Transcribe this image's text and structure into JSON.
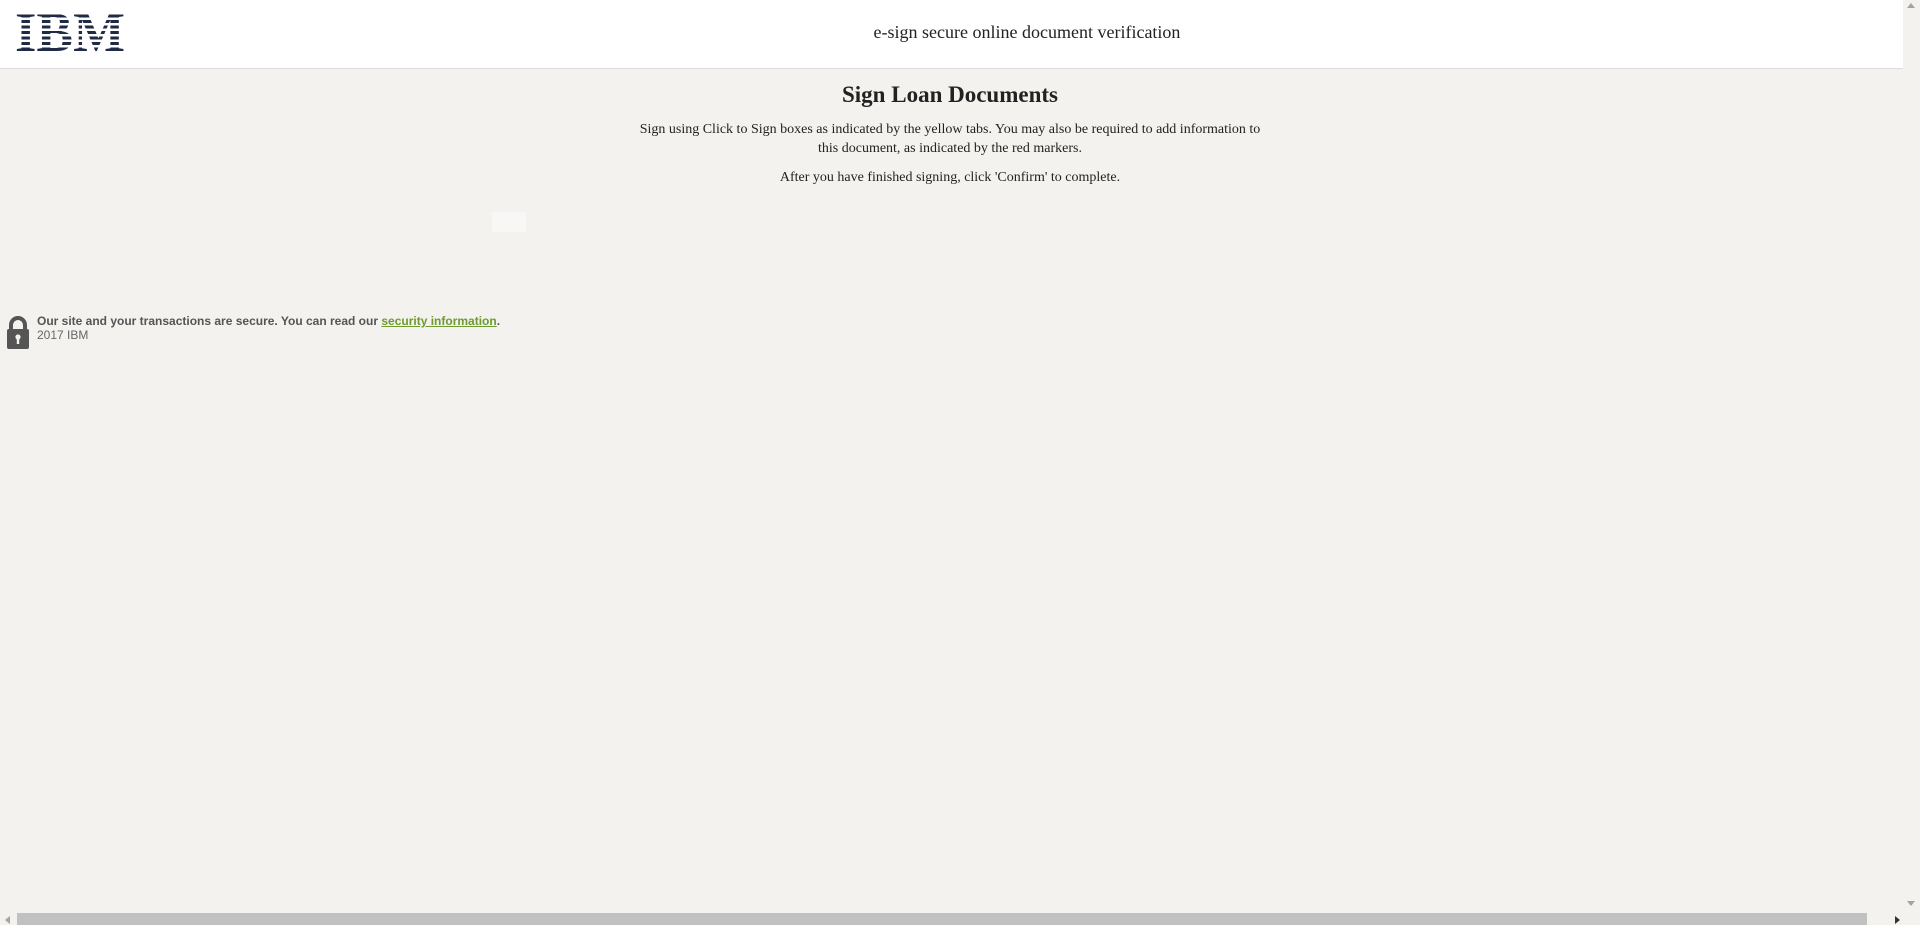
{
  "header": {
    "logo_text": "IBM",
    "title": "e-sign secure online document verification"
  },
  "main": {
    "title": "Sign Loan Documents",
    "instruction_1": "Sign using Click to Sign boxes as indicated by the yellow tabs. You may also be required to add information to this document, as indicated by the red markers.",
    "instruction_2": "After you have finished signing, click 'Confirm' to complete."
  },
  "footer": {
    "icon": "lock-icon",
    "secure_text": "Our site and your transactions are secure. You can read our",
    "link_text": "security information",
    "period": ".",
    "copyright": "2017 IBM"
  },
  "colors": {
    "background": "#f3f2ef",
    "link": "#6e9a2f",
    "logo": "#1f2a44"
  }
}
